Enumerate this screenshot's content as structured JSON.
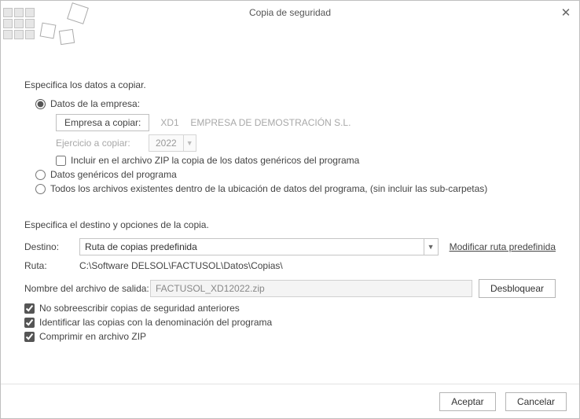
{
  "window": {
    "title": "Copia de seguridad"
  },
  "section1": {
    "title": "Especifica los datos a copiar.",
    "opt_datos_empresa": "Datos de la empresa:",
    "btn_empresa": "Empresa a copiar:",
    "empresa_code": "XD1",
    "empresa_name": "EMPRESA DE DEMOSTRACIÓN S.L.",
    "lbl_ejercicio": "Ejercicio a copiar:",
    "ejercicio_year": "2022",
    "chk_incluir": "Incluir en el archivo ZIP la copia de los datos genéricos del programa",
    "opt_genericos": "Datos genéricos del programa",
    "opt_todos": "Todos los archivos existentes dentro de la ubicación de datos del programa, (sin incluir las sub-carpetas)"
  },
  "section2": {
    "title": "Especifica el destino y opciones de la copia.",
    "lbl_destino": "Destino:",
    "destino_value": "Ruta de copias predefinida",
    "link_modificar": "Modificar ruta predefinida",
    "lbl_ruta": "Ruta:",
    "ruta_value": "C:\\Software DELSOL\\FACTUSOL\\Datos\\Copias\\",
    "lbl_nombre": "Nombre del archivo de salida:",
    "nombre_value": "FACTUSOL_XD12022.zip",
    "btn_desbloquear": "Desbloquear",
    "chk_nosobre": "No sobreescribir copias de seguridad anteriores",
    "chk_ident": "Identificar las copias con la denominación del programa",
    "chk_zip": "Comprimir en archivo ZIP"
  },
  "footer": {
    "aceptar": "Aceptar",
    "cancelar": "Cancelar"
  }
}
